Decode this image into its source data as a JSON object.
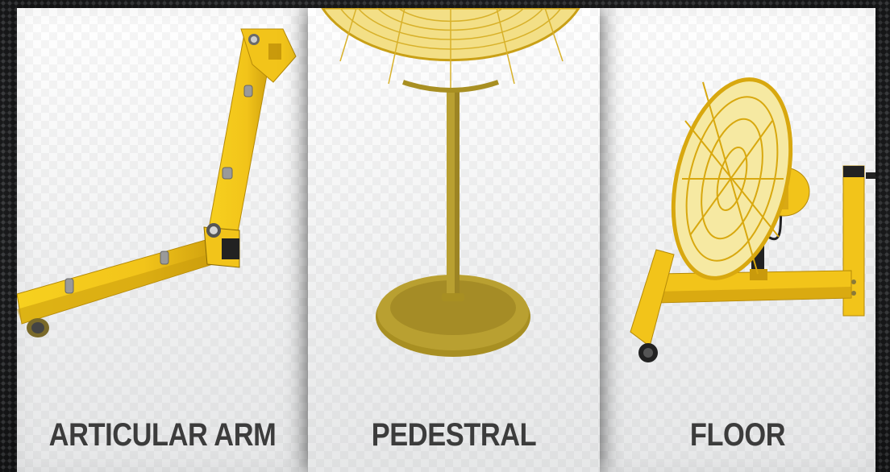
{
  "colors": {
    "fan_yellow": "#f2c41a",
    "fan_yellow_dark": "#c99a0c",
    "olive_yellow": "#b9a031",
    "label_gray": "#3c3c3c",
    "card_bg": "#f2f2f2",
    "frame_dark": "#2a2b2d"
  },
  "cards": [
    {
      "label": "ARTICULAR ARM",
      "image": "articulated-arm-mount-image"
    },
    {
      "label": "PEDESTRAL",
      "image": "pedestal-fan-image"
    },
    {
      "label": "FLOOR",
      "image": "floor-fan-image"
    }
  ]
}
